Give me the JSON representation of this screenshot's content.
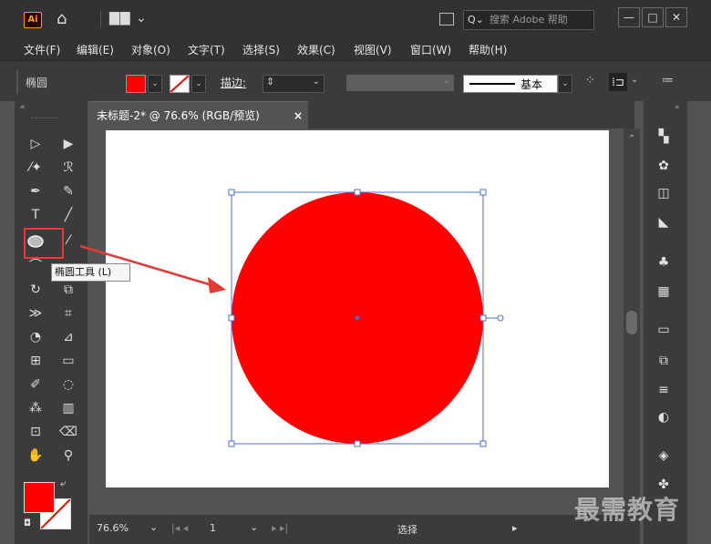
{
  "titlebar": {
    "logo": "Ai",
    "search_placeholder": "搜索 Adobe 帮助",
    "window_min": "—",
    "window_max": "□",
    "window_close": "✕"
  },
  "menu": [
    "文件(F)",
    "编辑(E)",
    "对象(O)",
    "文字(T)",
    "选择(S)",
    "效果(C)",
    "视图(V)",
    "窗口(W)",
    "帮助(H)"
  ],
  "control": {
    "selection_label": "椭圆",
    "stroke_label": "描边",
    "stroke_sep": ":",
    "stroke_style": "基本",
    "fill_color": "#ff0000"
  },
  "document": {
    "tab_title": "未标题-2* @ 76.6% (RGB/预览)",
    "tab_close": "×",
    "zoom": "76.6%",
    "artboard_number": "1",
    "status_text": "选择"
  },
  "tooltip": {
    "text": "椭圆工具 (L)"
  },
  "watermark": "最需教育",
  "colors": {
    "circle_fill": "#ff0000",
    "selection_blue": "#4a6ed8",
    "callout_red": "#e53935"
  }
}
